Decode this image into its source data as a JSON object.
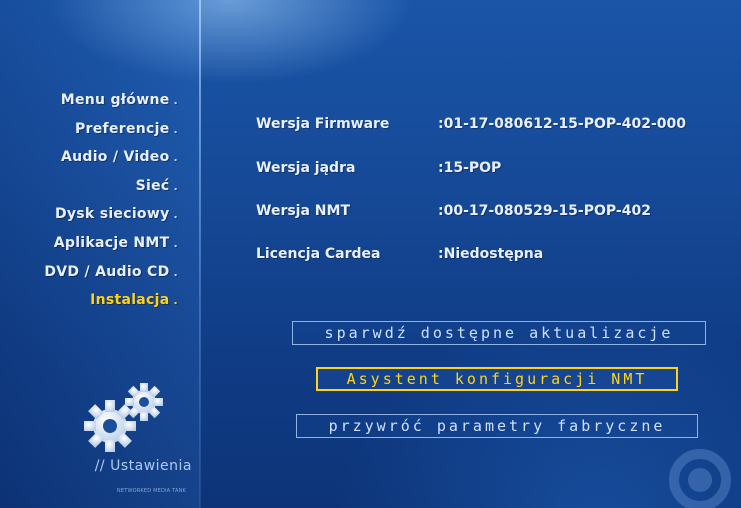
{
  "sidebar": {
    "items": [
      {
        "label": "Menu główne",
        "bullet": "."
      },
      {
        "label": "Preferencje",
        "bullet": "."
      },
      {
        "label": "Audio / Video",
        "bullet": "."
      },
      {
        "label": "Sieć",
        "bullet": "."
      },
      {
        "label": "Dysk sieciowy",
        "bullet": "."
      },
      {
        "label": "Aplikacje NMT",
        "bullet": "."
      },
      {
        "label": "DVD / Audio CD",
        "bullet": "."
      },
      {
        "label": "Instalacja",
        "bullet": ".",
        "active": true
      }
    ],
    "section_title": "// Ustawienia",
    "footer_small": "NETWORKED MEDIA TANK"
  },
  "info": {
    "firmware": {
      "label": "Wersja Firmware",
      "value": ":01-17-080612-15-POP-402-000"
    },
    "kernel": {
      "label": "Wersja jądra",
      "value": ":15-POP"
    },
    "nmt": {
      "label": "Wersja NMT",
      "value": ":00-17-080529-15-POP-402"
    },
    "cardea": {
      "label": "Licencja Cardea",
      "value": ":Niedostępna"
    }
  },
  "buttons": {
    "check_updates": "sparwdź dostępne aktualizacje",
    "wizard": "Asystent konfiguracji NMT",
    "factory_reset": "przywróć parametry fabryczne"
  },
  "colors": {
    "background": "#164a98",
    "text": "#e9f0ff",
    "accent": "#ffd21a",
    "button_border": "#8fb3e3"
  },
  "icons": {
    "settings": "gears-icon"
  }
}
